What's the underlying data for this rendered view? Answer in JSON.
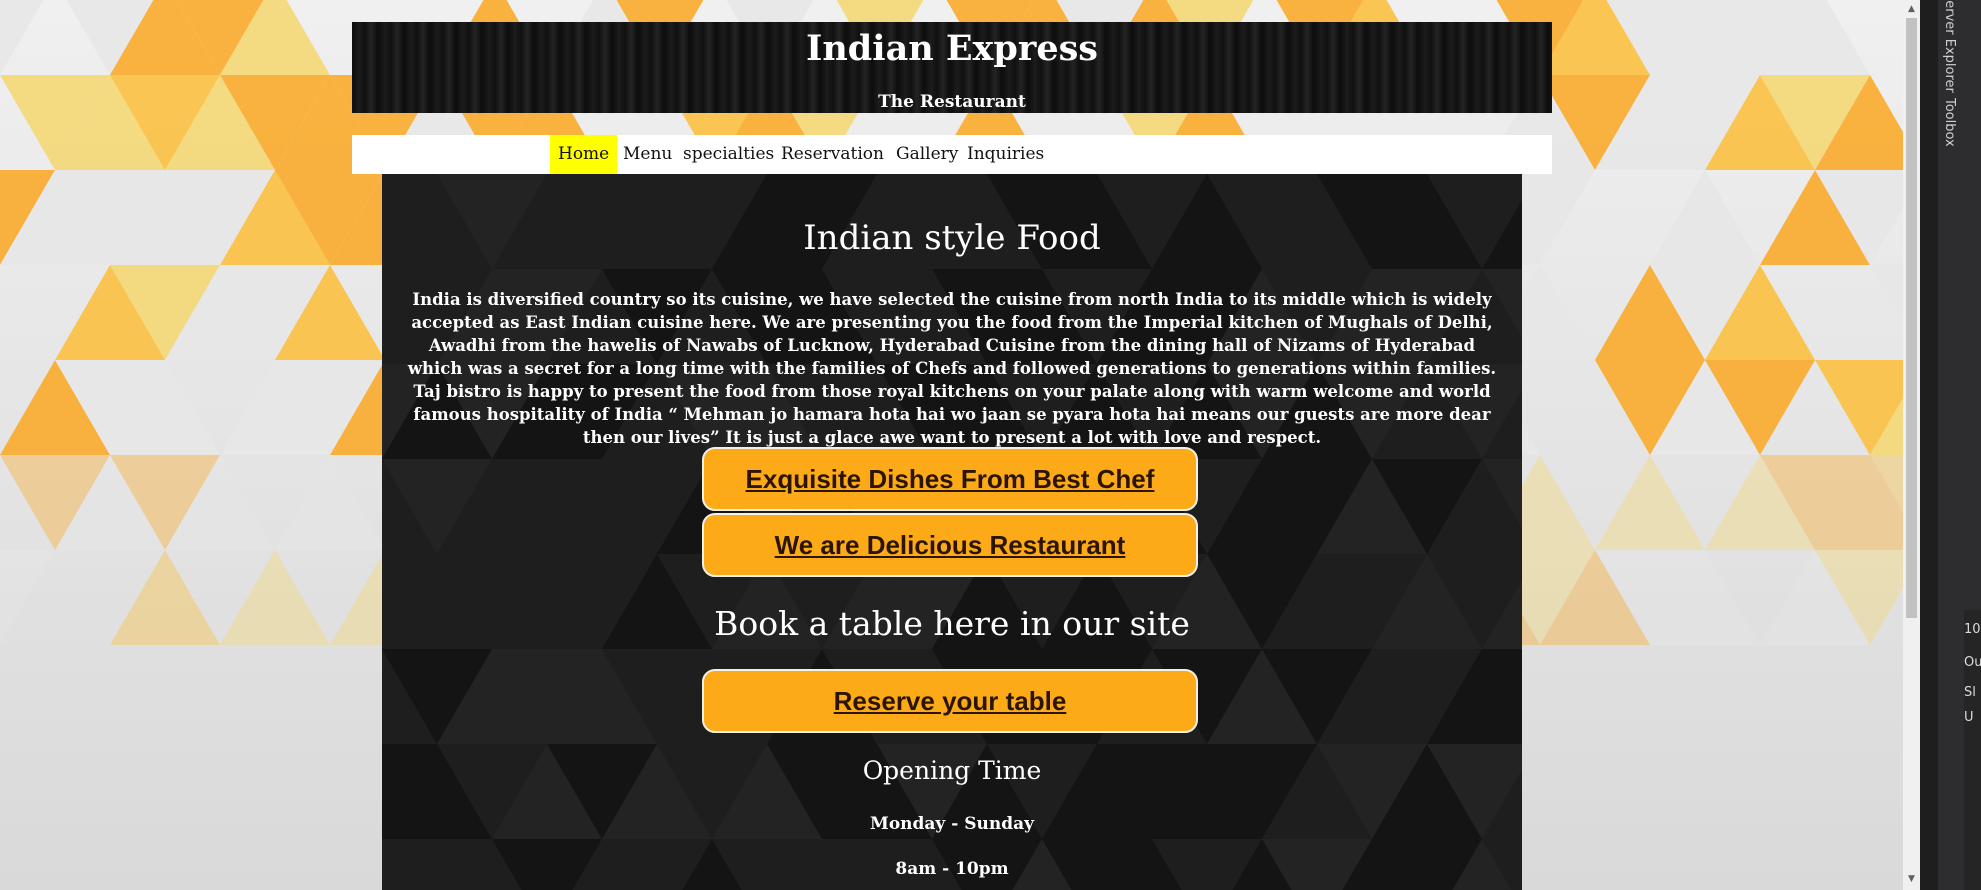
{
  "colors": {
    "accent": "#fdaa18",
    "nav_active": "#ffff00",
    "panel": "#1e1e1e",
    "header": "#111111",
    "tri_orange": "#f9ab2b",
    "tri_yellow": "#f4d774",
    "tri_light": "#e7e7e7"
  },
  "header": {
    "title": "Indian Express",
    "subtitle": "The Restaurant"
  },
  "nav": {
    "items": [
      {
        "label": "Home",
        "active": true
      },
      {
        "label": "Menu"
      },
      {
        "label": "specialties"
      },
      {
        "label": "Reservation"
      },
      {
        "label": "Gallery"
      },
      {
        "label": "Inquiries"
      }
    ]
  },
  "main": {
    "heading": "Indian style Food",
    "intro": "India is diversified country so its cuisine, we have selected the cuisine from north India to its middle which is widely accepted as East Indian cuisine here. We are presenting you the food from the Imperial kitchen of Mughals of Delhi, Awadhi from the hawelis of Nawabs of Lucknow, Hyderabad Cuisine from the dining hall of Nizams of Hyderabad which was a secret for a long time with the families of Chefs and followed generations to generations within families. Taj bistro is happy to present the food from those royal kitchens on your palate along with warm welcome and world famous hospitality of India “ Mehman jo hamara hota hai wo jaan se pyara hota hai means our guests are more dear then our lives”   It is just a glace awe want to present a lot with love and respect.",
    "button_chef": "Exquisite Dishes From Best Chef",
    "button_delicious": "We are Delicious Restaurant",
    "book_heading": "Book a table here in our site",
    "button_reserve": "Reserve your table",
    "opening_heading": "Opening Time",
    "days": "Monday - Sunday",
    "hours": "8am - 10pm"
  },
  "ide": {
    "tab_server_explorer": "Server Explorer",
    "tab_toolbox": "Toolbox",
    "frag_1": "10",
    "frag_2": "Ou",
    "frag_3": "Sl",
    "frag_4": "U"
  },
  "icons": [
    "scroll-up-icon",
    "scroll-down-icon"
  ]
}
